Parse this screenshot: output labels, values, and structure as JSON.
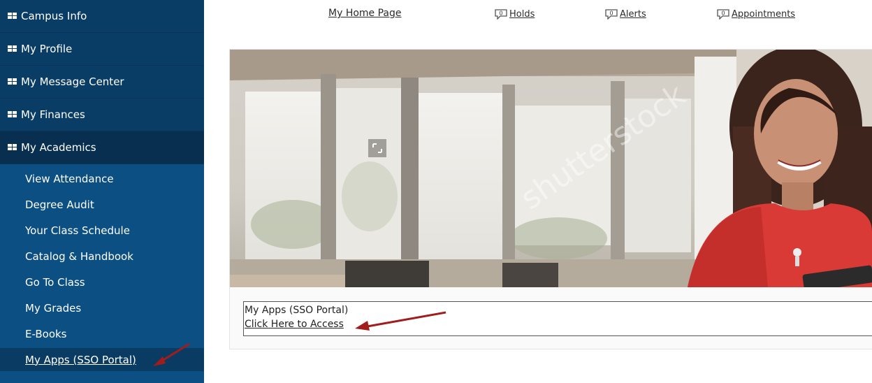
{
  "sidebar": {
    "menus": [
      {
        "label": "Campus Info"
      },
      {
        "label": "My Profile"
      },
      {
        "label": "My Message Center"
      },
      {
        "label": "My Finances"
      },
      {
        "label": "My Academics"
      }
    ],
    "sub_items": [
      {
        "label": "View Attendance"
      },
      {
        "label": "Degree Audit"
      },
      {
        "label": "Your Class Schedule"
      },
      {
        "label": "Catalog & Handbook"
      },
      {
        "label": "Go To Class"
      },
      {
        "label": "My Grades"
      },
      {
        "label": "E-Books"
      },
      {
        "label": "My Apps (SSO Portal)"
      }
    ]
  },
  "topnav": {
    "home": "My Home Page",
    "holds": {
      "count": "0",
      "label": "Holds"
    },
    "alerts": {
      "count": "0",
      "label": "Alerts"
    },
    "appointments": {
      "count": "0",
      "label": "Appointments"
    }
  },
  "apps": {
    "title": "My Apps (SSO Portal)",
    "link": "Click Here to Access"
  },
  "colors": {
    "sidebar_bg": "#0c4f82",
    "menu_bg": "#0a3d66",
    "arrow": "#a31c1c"
  }
}
